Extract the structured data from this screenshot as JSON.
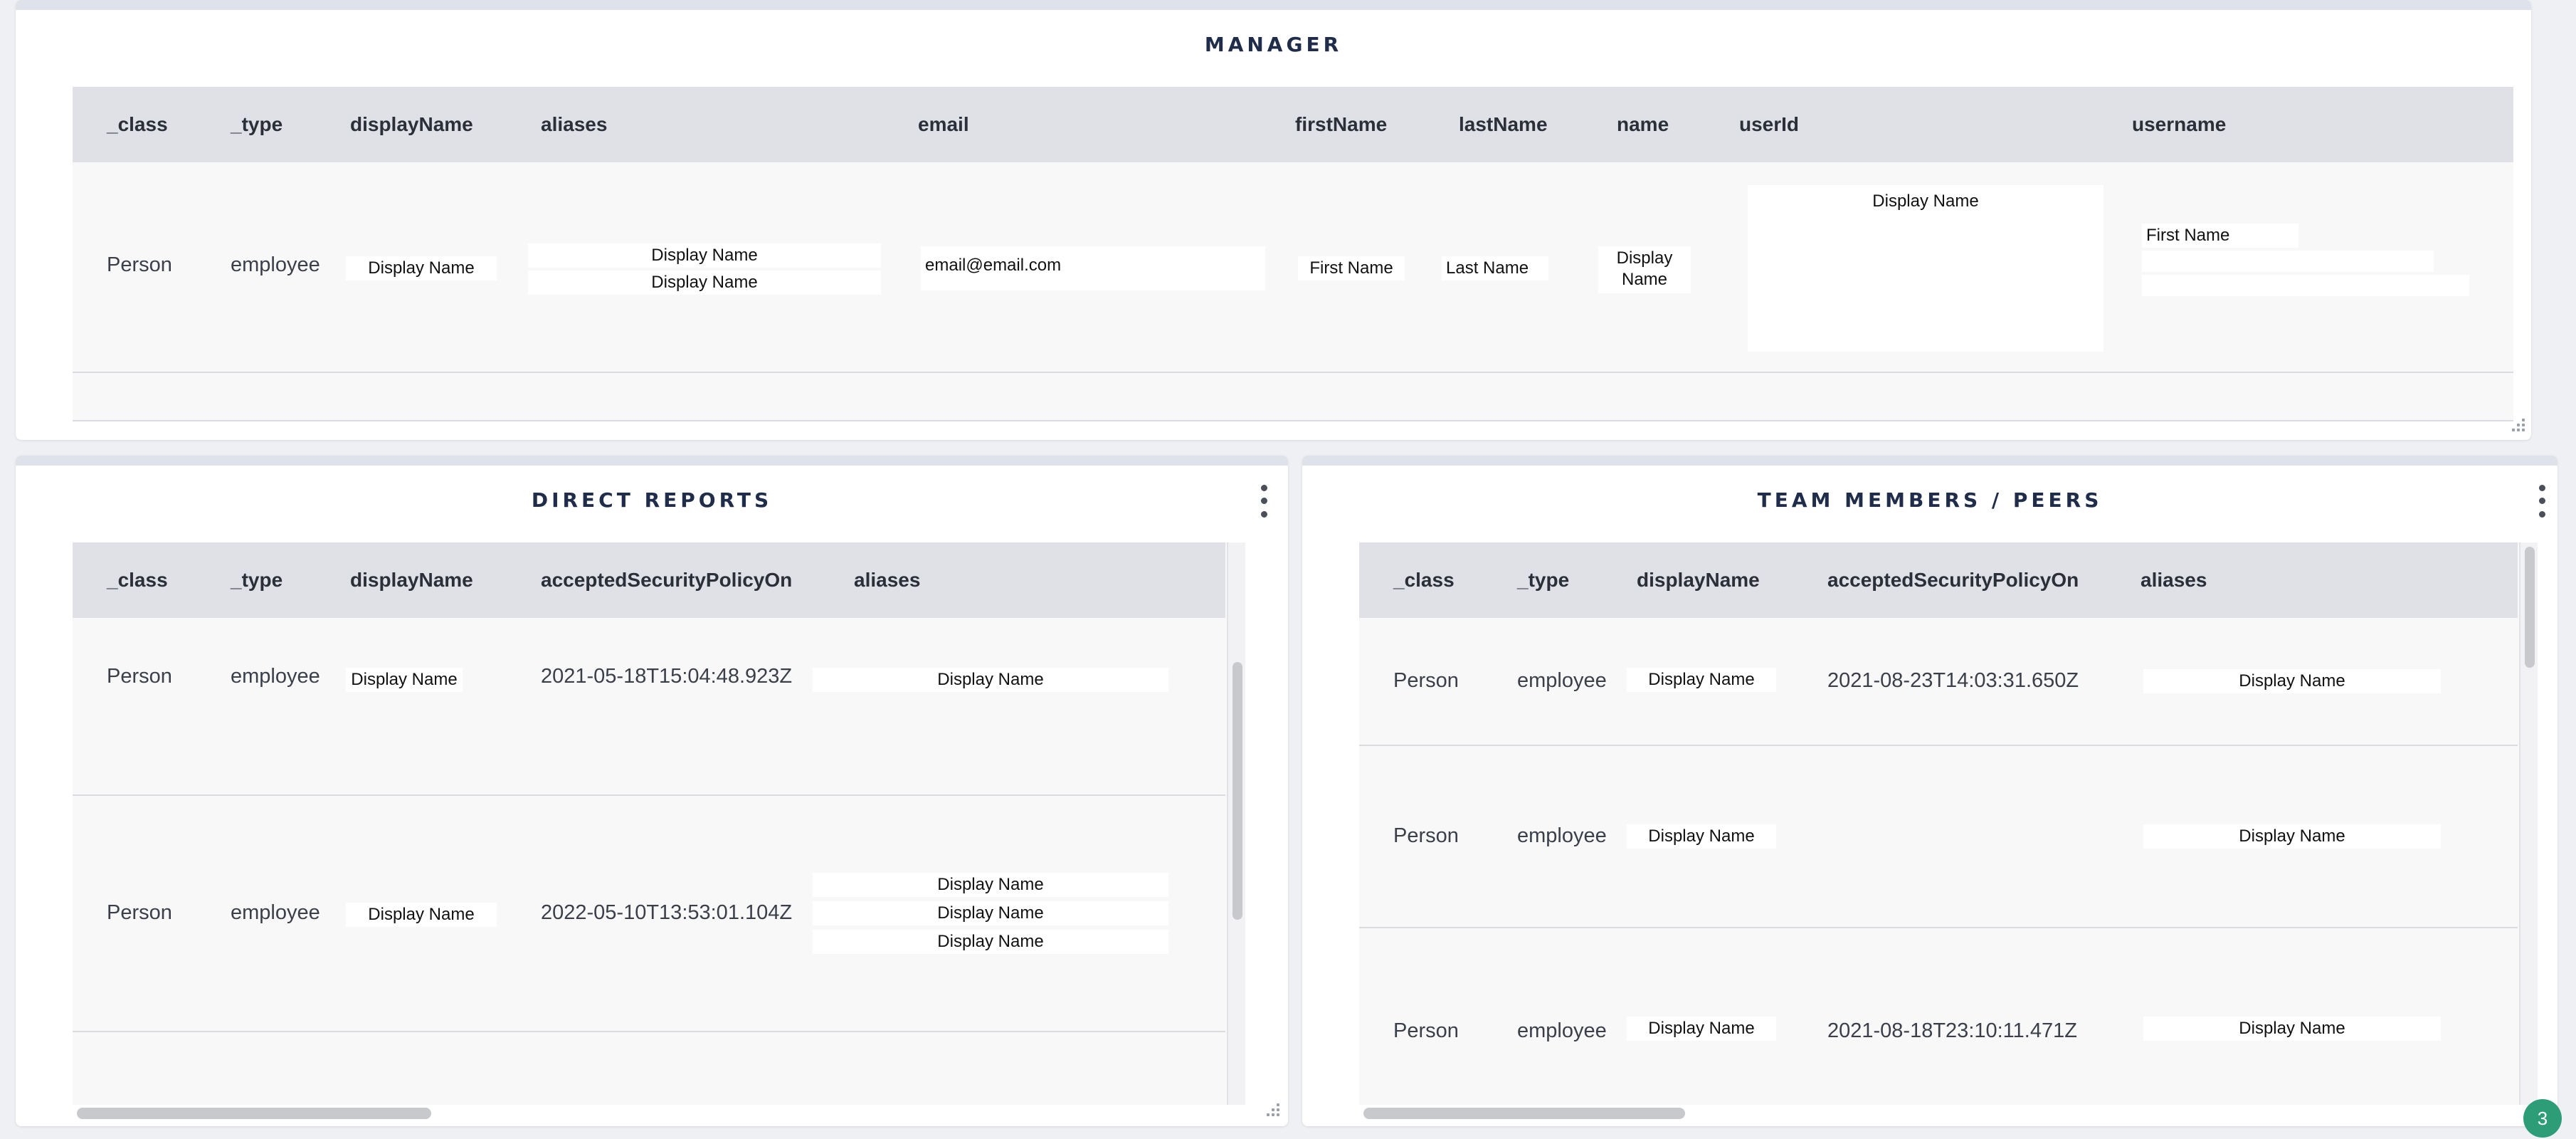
{
  "manager": {
    "title": "MANAGER",
    "columns": [
      "_class",
      "_type",
      "displayName",
      "aliases",
      "email",
      "firstName",
      "lastName",
      "name",
      "userId",
      "username"
    ],
    "row": {
      "class": "Person",
      "type": "employee",
      "displayName": "Display Name",
      "aliases": [
        "Display Name",
        "Display Name"
      ],
      "email": "email@email.com",
      "firstName": "First Name",
      "lastName": "Last Name",
      "name": "Display Name",
      "userId": "Display Name",
      "username": "First Name"
    }
  },
  "direct_reports": {
    "title": "DIRECT REPORTS",
    "columns": [
      "_class",
      "_type",
      "displayName",
      "acceptedSecurityPolicyOn",
      "aliases"
    ],
    "rows": [
      {
        "class": "Person",
        "type": "employee",
        "displayName": "Display Name",
        "accepted": "2021-05-18T15:04:48.923Z",
        "aliases": [
          "Display Name"
        ]
      },
      {
        "class": "Person",
        "type": "employee",
        "displayName": "Display Name",
        "accepted": "2022-05-10T13:53:01.104Z",
        "aliases": [
          "Display Name",
          "Display Name",
          "Display Name"
        ]
      }
    ]
  },
  "team_members": {
    "title": "TEAM MEMBERS / PEERS",
    "columns": [
      "_class",
      "_type",
      "displayName",
      "acceptedSecurityPolicyOn",
      "aliases"
    ],
    "rows": [
      {
        "class": "Person",
        "type": "employee",
        "displayName": "Display Name",
        "accepted": "2021-08-23T14:03:31.650Z",
        "aliases": [
          "Display Name"
        ]
      },
      {
        "class": "Person",
        "type": "employee",
        "displayName": "Display Name",
        "accepted": "",
        "aliases": [
          "Display Name"
        ]
      },
      {
        "class": "Person",
        "type": "employee",
        "displayName": "Display Name",
        "accepted": "2021-08-18T23:10:11.471Z",
        "aliases": [
          "Display Name"
        ]
      }
    ]
  },
  "notification_badge": "3",
  "icons": {
    "menu": "more-vertical-icon",
    "resize": "resize-handle-icon"
  }
}
